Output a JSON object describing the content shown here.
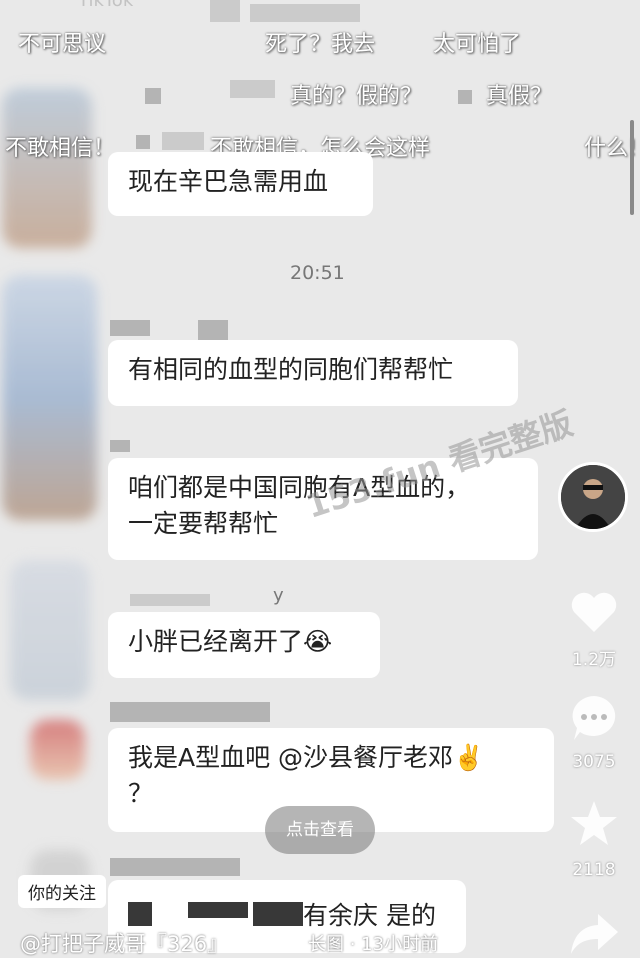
{
  "top_hint": "TikTok",
  "danmaku": [
    "不可思议",
    "死了？我去",
    "太可怕了",
    "真的？假的？",
    "真假？",
    "不敢相信！",
    "不敢相信，怎么会这样",
    "什么!"
  ],
  "messages": [
    {
      "text": "现在辛巴急需用血"
    },
    {
      "text": "有相同的血型的同胞们帮帮忙"
    },
    {
      "text": "咱们都是中国同胞有A型血的，\n一定要帮帮忙"
    },
    {
      "text": "小胖已经离开了😭"
    },
    {
      "text": "我是A型血吧 @沙县餐厅老邓✌️\n？"
    },
    {
      "text": "有余庆 是的"
    }
  ],
  "timestamp": "20:51",
  "sender_fragment": "y",
  "watermark": "153.fun 看完整版",
  "actions": {
    "like_count": "1.2万",
    "comment_count": "3075",
    "favorite_count": "2118"
  },
  "view_button": "点击查看",
  "follow_badge": "你的关注",
  "author": "@打把子威哥『326』",
  "post_meta": "长图 · 13小时前",
  "icons": {
    "like": "heart-icon",
    "comment": "comment-bubble-icon",
    "favorite": "star-icon",
    "share": "share-arrow-icon"
  }
}
